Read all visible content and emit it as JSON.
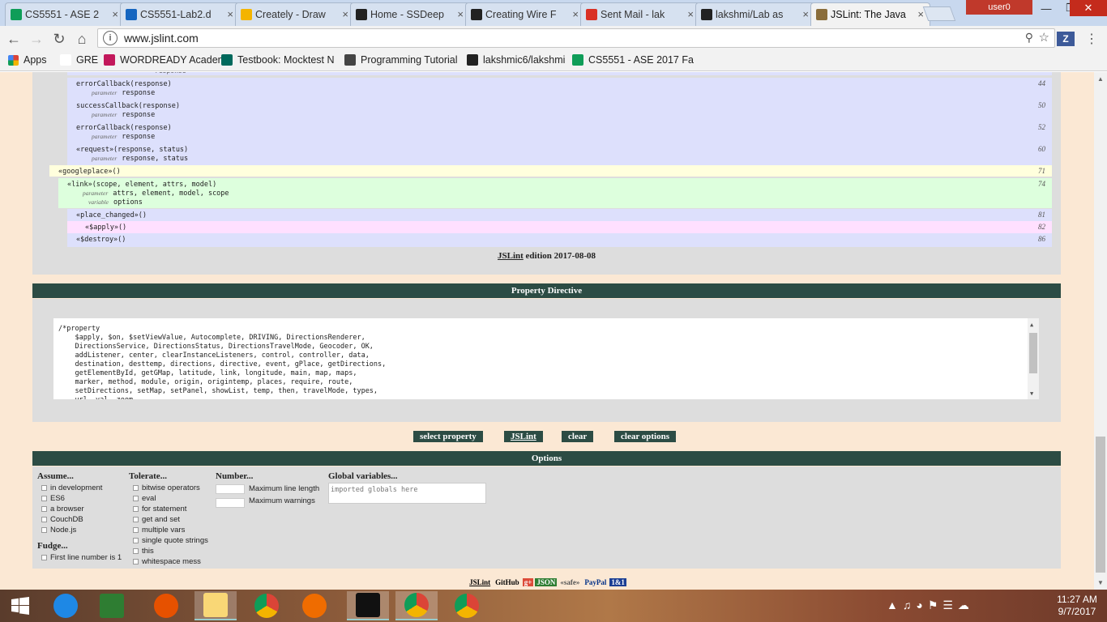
{
  "browser": {
    "tabs": [
      {
        "label": "CS5551 - ASE 2",
        "color": "#0f9d58",
        "icon": "sheets-icon"
      },
      {
        "label": "CS5551-Lab2.d",
        "color": "#1565c0",
        "icon": "box-icon"
      },
      {
        "label": "Creately - Draw",
        "color": "#f4b400",
        "icon": "bulb-icon"
      },
      {
        "label": "Home - SSDeep",
        "color": "#222222",
        "icon": "github-icon"
      },
      {
        "label": "Creating Wire F",
        "color": "#222222",
        "icon": "github-icon"
      },
      {
        "label": "Sent Mail - lak",
        "color": "#d93025",
        "icon": "gmail-icon"
      },
      {
        "label": "lakshmi/Lab as",
        "color": "#222222",
        "icon": "github-icon"
      },
      {
        "label": "JSLint: The Java",
        "color": "#8a6d3b",
        "icon": "jslint-icon"
      }
    ],
    "user": "user0",
    "url": "www.jslint.com",
    "apps_label": "Apps",
    "bookmarks": [
      {
        "label": "GRE",
        "color": "#ffffff"
      },
      {
        "label": "WORDREADY Academ",
        "color": "#c2185b"
      },
      {
        "label": "Testbook: Mocktest N",
        "color": "#00695c"
      },
      {
        "label": "Programming Tutorial",
        "color": "#444444"
      },
      {
        "label": "lakshmic6/lakshmi",
        "color": "#222222"
      },
      {
        "label": "CS5551 - ASE 2017 Fa",
        "color": "#0f9d58"
      }
    ]
  },
  "report": {
    "rows": [
      {
        "name": "errorCallback(response)",
        "sub": [
          [
            "parameter",
            "response"
          ]
        ],
        "line": "44",
        "bg": "#dde0fc",
        "indent": 54
      },
      {
        "name": "successCallback(response)",
        "sub": [
          [
            "parameter",
            "response"
          ]
        ],
        "line": "50",
        "bg": "#dde0fc",
        "indent": 54
      },
      {
        "name": "errorCallback(response)",
        "sub": [
          [
            "parameter",
            "response"
          ]
        ],
        "line": "52",
        "bg": "#dde0fc",
        "indent": 54
      },
      {
        "name": "«request»(response, status)",
        "sub": [
          [
            "parameter",
            "response, status"
          ]
        ],
        "line": "60",
        "bg": "#dde0fc",
        "indent": 54
      },
      {
        "name": "«googleplace»()",
        "sub": [],
        "line": "71",
        "bg": "#ffffdd",
        "indent": 32
      },
      {
        "name": "«link»(scope, element, attrs, model)",
        "sub": [
          [
            "parameter",
            "attrs, element, model, scope"
          ],
          [
            "variable",
            "options"
          ]
        ],
        "line": "74",
        "bg": "#ddffdd",
        "indent": 43
      },
      {
        "name": "«place_changed»()",
        "sub": [],
        "line": "81",
        "bg": "#dde0fc",
        "indent": 54
      },
      {
        "name": "«$apply»()",
        "sub": [],
        "line": "82",
        "bg": "#ffe0ff",
        "indent": 65
      },
      {
        "name": "«$destroy»()",
        "sub": [],
        "line": "86",
        "bg": "#dde0fc",
        "indent": 54
      }
    ],
    "partial_row_text": "response",
    "edition_link": "JSLint",
    "edition_text": " edition 2017-08-08"
  },
  "property": {
    "title": "Property Directive",
    "text": "/*property\n    $apply, $on, $setViewValue, Autocomplete, DRIVING, DirectionsRenderer,\n    DirectionsService, DirectionsStatus, DirectionsTravelMode, Geocoder, OK,\n    addListener, center, clearInstanceListeners, control, controller, data,\n    destination, desttemp, directions, directive, event, gPlace, getDirections,\n    getElementById, getGMap, latitude, link, longitude, main, map, maps,\n    marker, method, module, origin, origintemp, places, require, route,\n    setDirections, setMap, setPanel, showList, temp, then, travelMode, types,\n    url, val, zoom"
  },
  "buttons": {
    "select_property": "select property",
    "jslint": "JSLint",
    "clear": "clear",
    "clear_options": "clear options"
  },
  "options": {
    "title": "Options",
    "assume_head": "Assume...",
    "assume": [
      "in development",
      "ES6",
      "a browser",
      "CouchDB",
      "Node.js"
    ],
    "fudge_head": "Fudge...",
    "fudge": [
      "First line number is 1"
    ],
    "tolerate_head": "Tolerate...",
    "tolerate": [
      "bitwise operators",
      "eval",
      "for statement",
      "get and set",
      "multiple vars",
      "single quote strings",
      "this",
      "whitespace mess"
    ],
    "number_head": "Number...",
    "number": [
      "Maximum line length",
      "Maximum warnings"
    ],
    "globals_head": "Global variables...",
    "globals_placeholder": "imported globals here"
  },
  "footer": {
    "badges": [
      {
        "label": "JSLint",
        "bg": "#fbe8d4",
        "fg": "#000000"
      },
      {
        "label": "GitHub",
        "bg": "#fbe8d4",
        "fg": "#000000"
      },
      {
        "label": "g+",
        "bg": "#dd4b39",
        "fg": "#ffffff"
      },
      {
        "label": "JSON",
        "bg": "#2e7d32",
        "fg": "#ffffff"
      },
      {
        "label": "«safe»",
        "bg": "#fbe8d4",
        "fg": "#555555"
      },
      {
        "label": "PayPal",
        "bg": "#fbe8d4",
        "fg": "#003087"
      },
      {
        "label": "1&1",
        "bg": "#1c3f94",
        "fg": "#ffffff"
      }
    ]
  },
  "taskbar": {
    "time": "11:27 AM",
    "date": "9/7/2017",
    "apps": [
      {
        "name": "ie-icon",
        "color": "#1e88e5",
        "open": false
      },
      {
        "name": "store-icon",
        "color": "#2e7d32",
        "open": false
      },
      {
        "name": "firefox-icon",
        "color": "#e65100",
        "open": false
      },
      {
        "name": "file-explorer-icon",
        "color": "#f9d776",
        "open": true
      },
      {
        "name": "chrome-icon",
        "color": "#db4437",
        "open": false
      },
      {
        "name": "git-gui-icon",
        "color": "#ef6c00",
        "open": false
      },
      {
        "name": "webstorm-icon",
        "color": "#111111",
        "open": true
      },
      {
        "name": "chrome-icon",
        "color": "#db4437",
        "open": true
      },
      {
        "name": "chrome-icon",
        "color": "#db4437",
        "open": false
      }
    ]
  }
}
